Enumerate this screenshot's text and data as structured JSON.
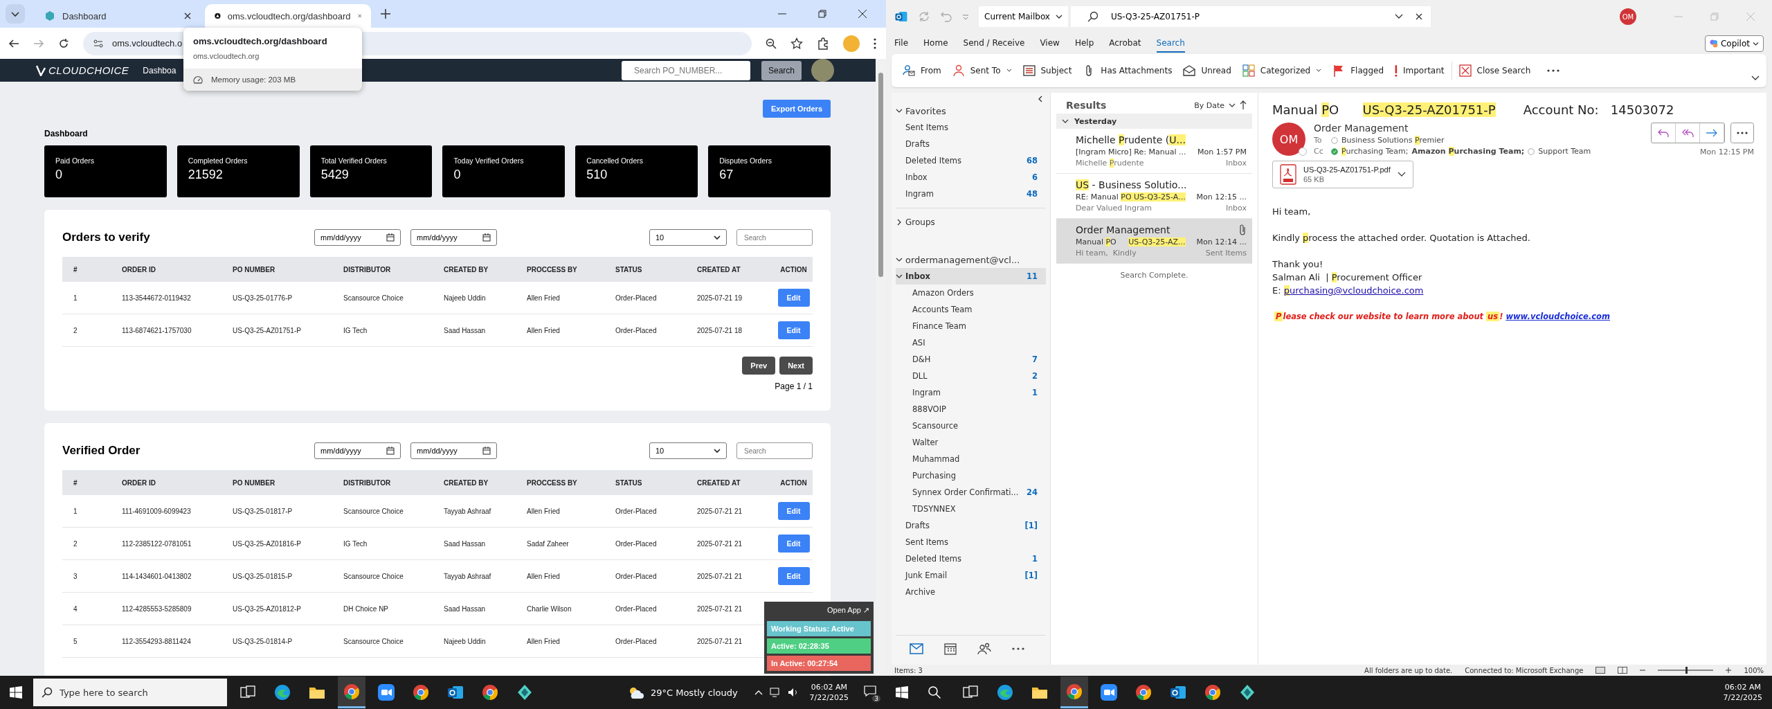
{
  "left_screen": {
    "browser": {
      "tabs": [
        {
          "title": "Dashboard",
          "selected": false
        },
        {
          "title": "oms.vcloudtech.org/dashboard",
          "selected": true
        }
      ],
      "address": "oms.vcloudtech.o",
      "tooltip": {
        "title": "oms.vcloudtech.org/dashboard",
        "host": "oms.vcloudtech.org",
        "memory": "Memory usage: 203 MB"
      }
    },
    "site": {
      "logo": "CLOUDCHOICE",
      "nav_item": "Dashboa",
      "search": {
        "placeholder": "Search PO_NUMBER..."
      },
      "search_button": "Search",
      "export_button": "Export Orders",
      "heading": "Dashboard",
      "stats": [
        {
          "label": "Paid Orders",
          "value": "0"
        },
        {
          "label": "Completed Orders",
          "value": "21592"
        },
        {
          "label": "Total Verified Orders",
          "value": "5429"
        },
        {
          "label": "Today Verified Orders",
          "value": "0"
        },
        {
          "label": "Cancelled Orders",
          "value": "510"
        },
        {
          "label": "Disputes Orders",
          "value": "67"
        }
      ],
      "tables": [
        {
          "title": "Orders to verify",
          "date_from": {
            "placeholder": "mm/dd/yyyy"
          },
          "date_to": {
            "placeholder": "mm/dd/yyyy"
          },
          "page_size": "10",
          "search": {
            "placeholder": "Search"
          },
          "columns": [
            "#",
            "ORDER ID",
            "PO NUMBER",
            "DISTRIBUTOR",
            "CREATED BY",
            "PROCCESS BY",
            "STATUS",
            "CREATED AT",
            "ACTION"
          ],
          "rows": [
            {
              "cells": [
                "1",
                "113-3544672-0119432",
                "US-Q3-25-01776-P",
                "Scansource Choice",
                "Najeeb Uddin",
                "Allen Fried",
                "Order-Placed",
                "2025-07-21 19"
              ],
              "action": "Edit"
            },
            {
              "cells": [
                "2",
                "113-6874621-1757030",
                "US-Q3-25-AZ01751-P",
                "IG Tech",
                "Saad Hassan",
                "Allen Fried",
                "Order-Placed",
                "2025-07-21 18"
              ],
              "action": "Edit"
            }
          ],
          "pager": {
            "prev": "Prev",
            "next": "Next",
            "page": "Page 1 / 1"
          }
        },
        {
          "title": "Verified Order",
          "date_from": {
            "placeholder": "mm/dd/yyyy"
          },
          "date_to": {
            "placeholder": "mm/dd/yyyy"
          },
          "page_size": "10",
          "search": {
            "placeholder": "Search"
          },
          "columns": [
            "#",
            "ORDER ID",
            "PO NUMBER",
            "DISTRIBUTOR",
            "CREATED BY",
            "PROCCESS BY",
            "STATUS",
            "CREATED AT",
            "ACTION"
          ],
          "rows": [
            {
              "cells": [
                "1",
                "111-4691009-6099423",
                "US-Q3-25-01817-P",
                "Scansource Choice",
                "Tayyab Ashraaf",
                "Allen Fried",
                "Order-Placed",
                "2025-07-21 21"
              ],
              "action": "Edit"
            },
            {
              "cells": [
                "2",
                "112-2385122-0781051",
                "US-Q3-25-AZ01816-P",
                "IG Tech",
                "Saad Hassan",
                "Sadaf Zaheer",
                "Order-Placed",
                "2025-07-21 21"
              ],
              "action": "Edit"
            },
            {
              "cells": [
                "3",
                "114-1434601-0413802",
                "US-Q3-25-01815-P",
                "Scansource Choice",
                "Tayyab Ashraaf",
                "Allen Fried",
                "Order-Placed",
                "2025-07-21 21"
              ],
              "action": "Edit"
            },
            {
              "cells": [
                "4",
                "112-4285553-5285809",
                "US-Q3-25-AZ01812-P",
                "DH Choice NP",
                "Saad Hassan",
                "Charlie Wilson",
                "Order-Placed",
                "2025-07-21 21"
              ]
            },
            {
              "cells": [
                "5",
                "112-3554293-8811424",
                "US-Q3-25-01814-P",
                "Scansource Choice",
                "Najeeb Uddin",
                "Allen Fried",
                "Order-Placed",
                "2025-07-21 21"
              ]
            }
          ]
        }
      ]
    },
    "widget": {
      "open_app": "Open App ↗",
      "lines": [
        {
          "text": "Working Status: Active",
          "color": "#67c3cc"
        },
        {
          "text": "Active: 02:28:35",
          "color": "#4fcf83"
        },
        {
          "text": "In Active: 00:27:54",
          "color": "#e8665e"
        }
      ]
    },
    "taskbar": {
      "search": {
        "placeholder": "Type here to search"
      },
      "apps": [
        {
          "kind": "taskview",
          "active": false
        },
        {
          "kind": "edge",
          "active": false
        },
        {
          "kind": "folder",
          "active": false
        },
        {
          "kind": "chrome",
          "active": true
        },
        {
          "kind": "zoom",
          "active": false
        },
        {
          "kind": "chrome",
          "active": false
        },
        {
          "kind": "outlook",
          "active": false
        },
        {
          "kind": "chrome",
          "active": false
        },
        {
          "kind": "app",
          "active": false
        }
      ],
      "weather": "29°C Mostly cloudy",
      "time": "06:02 AM",
      "date": "7/22/2025",
      "notifications": "3"
    }
  },
  "right_screen": {
    "outlook": {
      "title_bar": {
        "scope": "Current Mailbox",
        "search": "US-Q3-25-AZ01751-P",
        "avatar": "OM"
      },
      "menu": [
        {
          "label": "File",
          "selected": false
        },
        {
          "label": "Home",
          "selected": false
        },
        {
          "label": "Send / Receive",
          "selected": false
        },
        {
          "label": "View",
          "selected": false
        },
        {
          "label": "Help",
          "selected": false
        },
        {
          "label": "Acrobat",
          "selected": false
        },
        {
          "label": "Search",
          "selected": true
        }
      ],
      "copilot": "Copilot",
      "ribbon": [
        {
          "label": "From",
          "kind": "from",
          "caret": false
        },
        {
          "label": "Sent To",
          "kind": "sentto",
          "caret": true
        },
        {
          "label": "Subject",
          "kind": "subject",
          "caret": false
        },
        {
          "label": "Has Attachments",
          "kind": "attach",
          "caret": false
        },
        {
          "label": "Unread",
          "kind": "unread",
          "caret": false
        },
        {
          "label": "Categorized",
          "kind": "categorized",
          "caret": true
        },
        {
          "label": "Flagged",
          "kind": "flag",
          "caret": false
        },
        {
          "label": "Important",
          "kind": "important",
          "caret": false
        },
        {
          "label": "Close Search",
          "kind": "close",
          "caret": false
        }
      ],
      "folders": {
        "favorites": {
          "label": "Favorites",
          "expanded": true,
          "items": [
            {
              "name": "Sent Items",
              "selected": false
            },
            {
              "name": "Drafts",
              "selected": false
            },
            {
              "name": "Deleted Items",
              "count": "68",
              "selected": false
            },
            {
              "name": "Inbox",
              "count": "6",
              "selected": false
            },
            {
              "name": "Ingram",
              "count": "48",
              "selected": false
            }
          ]
        },
        "groups": {
          "label": "Groups",
          "expanded": false
        },
        "account": {
          "label": "ordermanagement@vcl...",
          "expanded": true,
          "folders": [
            {
              "name": "Inbox",
              "count": "11",
              "selected": true,
              "expanded": true,
              "children": [
                {
                  "name": "Amazon Orders",
                  "selected": false
                },
                {
                  "name": "Accounts Team",
                  "selected": false
                },
                {
                  "name": "Finance Team",
                  "selected": false
                },
                {
                  "name": "ASI",
                  "selected": false
                },
                {
                  "name": "D&H",
                  "count": "7",
                  "selected": false
                },
                {
                  "name": "DLL",
                  "count": "2",
                  "selected": false
                },
                {
                  "name": "Ingram",
                  "count": "1",
                  "selected": false
                },
                {
                  "name": "888VOIP",
                  "selected": false
                },
                {
                  "name": "Scansource",
                  "selected": false
                },
                {
                  "name": "Walter",
                  "selected": false
                },
                {
                  "name": "Muhammad",
                  "selected": false
                },
                {
                  "name": "Purchasing",
                  "selected": false
                },
                {
                  "name": "Synnex Order Confirmati...",
                  "count": "24",
                  "selected": false
                },
                {
                  "name": "TDSYNNEX",
                  "selected": false
                }
              ]
            },
            {
              "name": "Drafts",
              "count": "[1]",
              "selected": false
            },
            {
              "name": "Sent Items",
              "selected": false
            },
            {
              "name": "Deleted Items",
              "count": "1",
              "selected": false
            },
            {
              "name": "Junk Email",
              "count": "[1]",
              "selected": false
            },
            {
              "name": "Archive",
              "selected": false
            }
          ]
        }
      },
      "results": {
        "title": "Results",
        "sort": "By Date",
        "group": "Yesterday",
        "messages": [
          {
            "sender": [
              {
                "t": "Michelle ",
                "hl": false
              },
              {
                "t": "P",
                "hl": true
              },
              {
                "t": "rudente (",
                "hl": false
              },
              {
                "t": "U...",
                "hl": true
              }
            ],
            "subject": [
              {
                "t": "[Ingram Micro] Re: Manual ...",
                "hl": false
              }
            ],
            "preview": [
              {
                "t": "Michelle ",
                "hl": false
              },
              {
                "t": "P",
                "hl": true
              },
              {
                "t": "rudente",
                "hl": false
              }
            ],
            "time": "Mon 1:57 PM",
            "folder": "Inbox",
            "selected": false,
            "attachment": false
          },
          {
            "sender": [
              {
                "t": "US",
                "hl": true
              },
              {
                "t": " - Business Solutio...",
                "hl": false
              }
            ],
            "subject": [
              {
                "t": "RE: Manual ",
                "hl": false
              },
              {
                "t": "PO",
                "hl": true
              },
              {
                "t": " US-Q3-25-A...",
                "hl": true
              }
            ],
            "preview": [
              {
                "t": "Dear Valued Ingram",
                "hl": false
              }
            ],
            "time": "Mon 12:15 ...",
            "folder": "Inbox",
            "selected": false,
            "attachment": false
          },
          {
            "sender": [
              {
                "t": "Order Management",
                "hl": false
              }
            ],
            "subject": [
              {
                "t": "Manual ",
                "hl": false
              },
              {
                "t": "P",
                "hl": true
              },
              {
                "t": "O     ",
                "hl": false
              },
              {
                "t": "US-Q3-25-AZ...",
                "hl": true
              }
            ],
            "preview": [
              {
                "t": "Hi team,  Kindly",
                "hl": false
              }
            ],
            "time": "Mon 12:14 ...",
            "folder": "Sent Items",
            "selected": true,
            "attachment": true
          }
        ],
        "status": "Search Complete."
      },
      "reading": {
        "subject": [
          {
            "t": "Manual ",
            "hl": false
          },
          {
            "t": "P",
            "hl": true
          },
          {
            "t": "O      ",
            "hl": false
          },
          {
            "t": "US-Q3-25-AZ01751-P",
            "hl": true
          },
          {
            "t": "       Account No:   14503072",
            "hl": false
          }
        ],
        "avatar": "OM",
        "sender": "Order Management",
        "time": "Mon 12:15 PM",
        "to_label": "To",
        "to": [
          {
            "parts": [
              {
                "t": "Business Solutions ",
                "hl": false
              },
              {
                "t": "P",
                "hl": true
              },
              {
                "t": "remier",
                "hl": false
              }
            ],
            "kind": "offline",
            "bold": false
          }
        ],
        "cc_label": "Cc",
        "cc": [
          {
            "parts": [
              {
                "t": "P",
                "hl": true
              },
              {
                "t": "urchasing Team;",
                "hl": false
              }
            ],
            "kind": "available",
            "bold": false
          },
          {
            "parts": [
              {
                "t": "Amazon ",
                "hl": false
              },
              {
                "t": "P",
                "hl": true
              },
              {
                "t": "urchasing Team;",
                "hl": false
              }
            ],
            "kind": "plain",
            "bold": true
          },
          {
            "parts": [
              {
                "t": "Support Team",
                "hl": false
              }
            ],
            "kind": "offline",
            "bold": false
          }
        ],
        "attachment": {
          "name": "US-Q3-25-AZ01751-P.pdf",
          "size": "65 KB"
        },
        "body": [
          [
            {
              "kind": "text",
              "parts": [
                {
                  "t": "Hi team,",
                  "hl": false
                }
              ]
            }
          ],
          [
            {
              "kind": "text",
              "parts": [
                {
                  "t": "Kindly ",
                  "hl": false
                },
                {
                  "t": "p",
                  "hl": true
                },
                {
                  "t": "rocess the attached order. Quotation is Attached.",
                  "hl": false
                }
              ]
            }
          ],
          [
            {
              "kind": "text",
              "parts": [
                {
                  "t": "Thank you!",
                  "hl": false
                }
              ]
            },
            {
              "kind": "text",
              "parts": [
                {
                  "t": "Salman Ali  | ",
                  "hl": false
                },
                {
                  "t": "P",
                  "hl": true
                },
                {
                  "t": "rocurement Officer",
                  "hl": false
                }
              ]
            },
            {
              "kind": "text",
              "parts": [
                {
                  "t": "E: ",
                  "hl": false
                }
              ],
              "link": [
                {
                  "t": "p",
                  "hl": true
                },
                {
                  "t": "urchasing@vcloudchoice.com",
                  "hl": false
                }
              ]
            }
          ],
          [
            {
              "kind": "promo",
              "parts": [
                {
                  "t": "P",
                  "hl": true
                },
                {
                  "t": "lease check our website to learn more about ",
                  "hl": false
                },
                {
                  "t": "us",
                  "hl": true
                },
                {
                  "t": "! ",
                  "hl": false
                }
              ],
              "link": [
                {
                  "t": "www.vcloudchoice.com",
                  "hl": false
                }
              ]
            }
          ]
        ]
      },
      "status_bar": {
        "items": "Items: 3",
        "sync": "All folders are up to date.",
        "connection": "Connected to: Microsoft Exchange",
        "zoom": "100%",
        "zoom_slider": {
          "level": 0.5
        }
      }
    },
    "taskbar": {
      "apps": [
        {
          "kind": "taskview",
          "active": false
        },
        {
          "kind": "edge",
          "active": false
        },
        {
          "kind": "folder",
          "active": false
        },
        {
          "kind": "chrome",
          "active": true
        },
        {
          "kind": "zoom",
          "active": false
        },
        {
          "kind": "chrome",
          "active": false
        },
        {
          "kind": "outlook",
          "active": false
        },
        {
          "kind": "chrome",
          "active": false
        },
        {
          "kind": "app",
          "active": false
        }
      ],
      "time": "06:02 AM",
      "date": "7/22/2025"
    }
  }
}
